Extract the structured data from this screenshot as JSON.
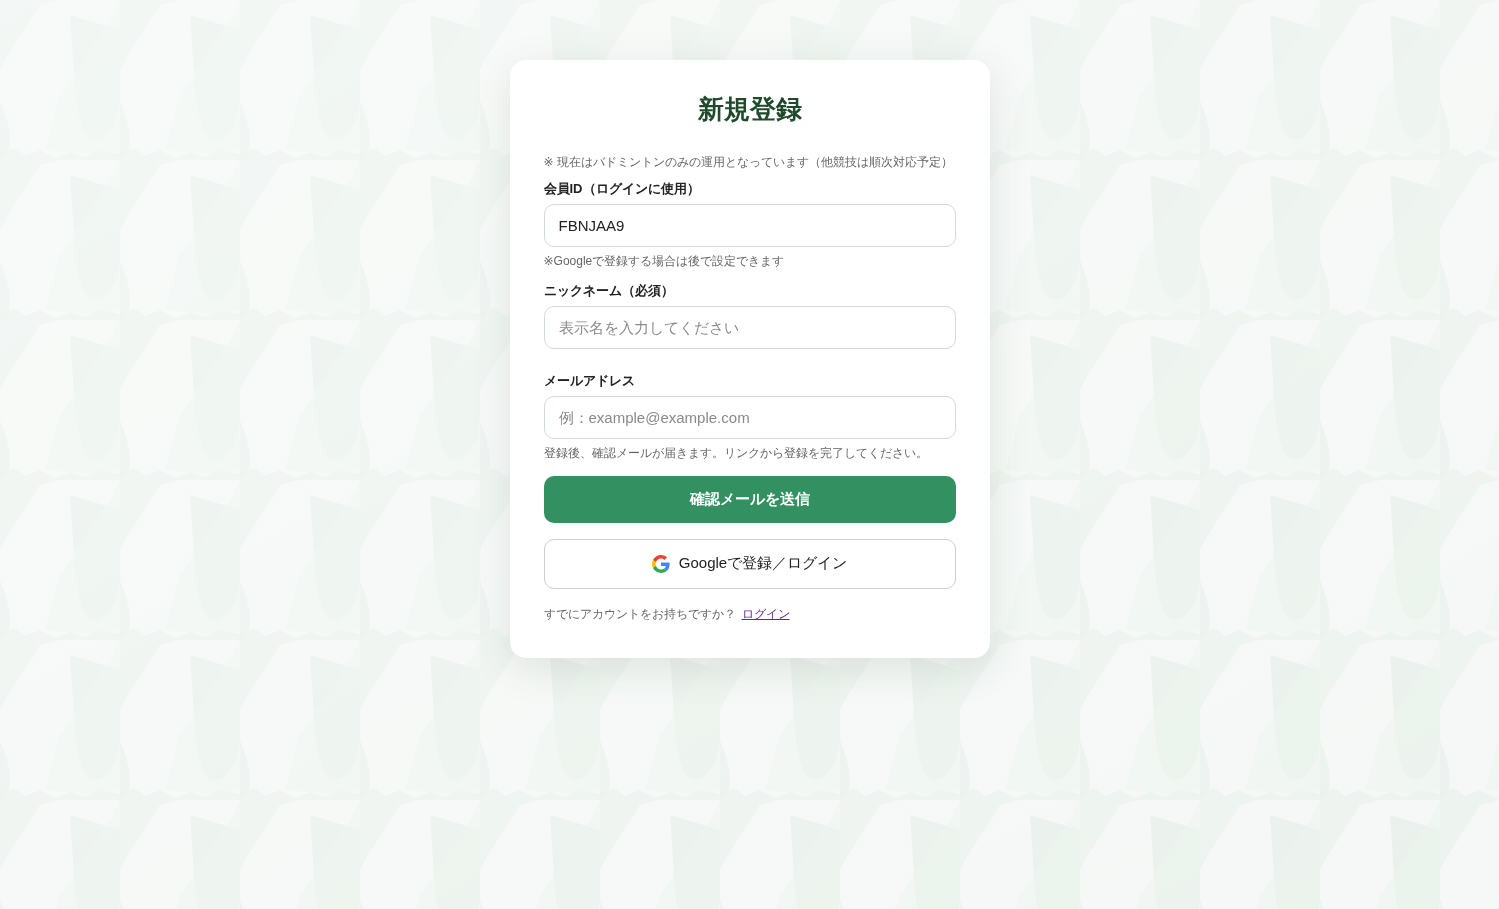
{
  "title": "新規登録",
  "notice": "※ 現在はバドミントンのみの運用となっています（他競技は順次対応予定）",
  "fields": [
    {
      "label": "会員ID（ログインに使用）",
      "value": "FBNJAA9",
      "hint": "※Googleで登録する場合は後で設定できます"
    },
    {
      "label": "ニックネーム（必須）",
      "placeholder": "表示名を入力してください"
    },
    {
      "label": "メールアドレス",
      "placeholder": "例：example@example.com",
      "hint": "登録後、確認メールが届きます。リンクから登録を完了してください。"
    }
  ],
  "submit_button": "確認メールを送信",
  "google_button": "Googleで登録／ログイン",
  "login_prompt": {
    "text": "すでにアカウントをお持ちですか？",
    "link": "ログイン"
  }
}
